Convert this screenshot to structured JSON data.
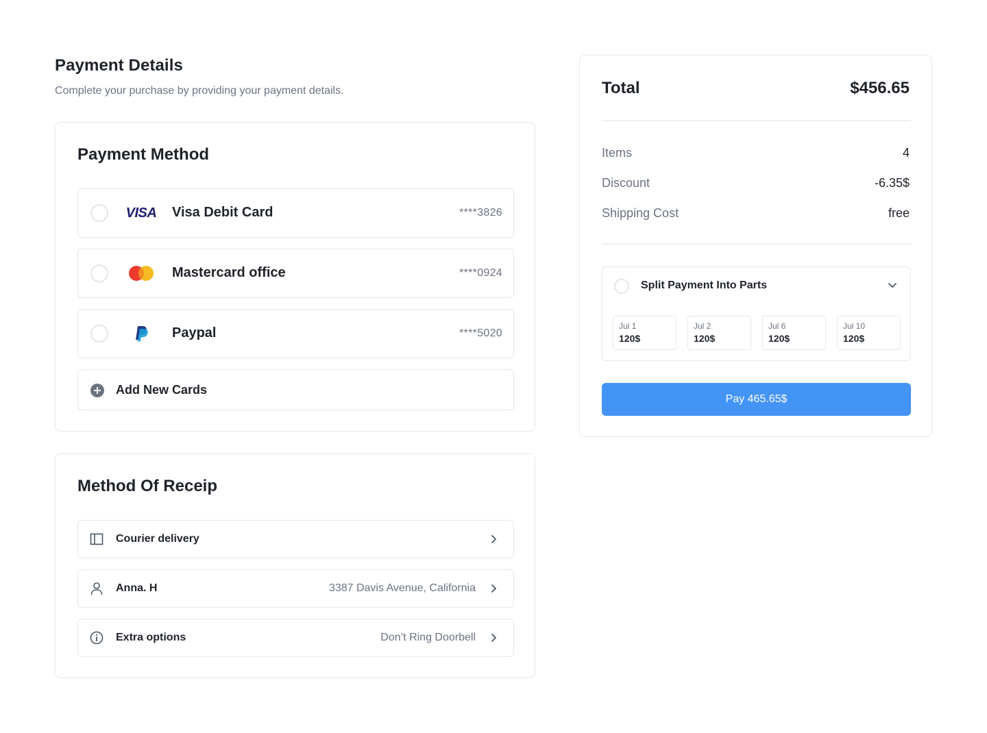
{
  "header": {
    "title": "Payment Details",
    "subtitle": "Complete your purchase by providing your payment details."
  },
  "payment_method": {
    "title": "Payment Method",
    "options": [
      {
        "name": "Visa Debit Card",
        "number": "****3826",
        "logo": "visa-logo",
        "logo_text": "VISA",
        "selected": false
      },
      {
        "name": "Mastercard office",
        "number": "****0924",
        "logo": "mastercard-logo",
        "selected": false
      },
      {
        "name": "Paypal",
        "number": "****5020",
        "logo": "paypal-logo",
        "selected": false
      }
    ],
    "add_label": "Add New Cards",
    "add_icon": "plus-circle-icon"
  },
  "receipt": {
    "title": "Method Of Receip",
    "rows": [
      {
        "label": "Courier delivery",
        "value": "",
        "icon": "sidebar-layout-icon"
      },
      {
        "label": "Anna. H",
        "value": "3387 Davis Avenue, California",
        "icon": "user-icon"
      },
      {
        "label": "Extra options",
        "value": "Don’t Ring Doorbell",
        "icon": "info-icon"
      }
    ]
  },
  "summary": {
    "total_label": "Total",
    "total_value": "$456.65",
    "rows": [
      {
        "label": "Items",
        "value": "4"
      },
      {
        "label": "Discount",
        "value": "-6.35$"
      },
      {
        "label": "Shipping Cost",
        "value": "free"
      }
    ],
    "split": {
      "title": "Split Payment Into Parts",
      "selected": false,
      "parts": [
        {
          "date": "Jul 1",
          "amount": "120$"
        },
        {
          "date": "Jul 2",
          "amount": "120$"
        },
        {
          "date": "Jul 6",
          "amount": "120$"
        },
        {
          "date": "Jul 10",
          "amount": "120$"
        }
      ]
    },
    "pay_label": "Pay 465.65$"
  },
  "colors": {
    "accent": "#4394f5",
    "text": "#1f2329",
    "muted": "#6b7280",
    "border": "#e6e8eb",
    "visa": "#1a1f71",
    "mastercard_red": "#eb3b2f",
    "mastercard_yellow": "#f5b616",
    "paypal_dark": "#253b80",
    "paypal_light": "#179bd7"
  }
}
